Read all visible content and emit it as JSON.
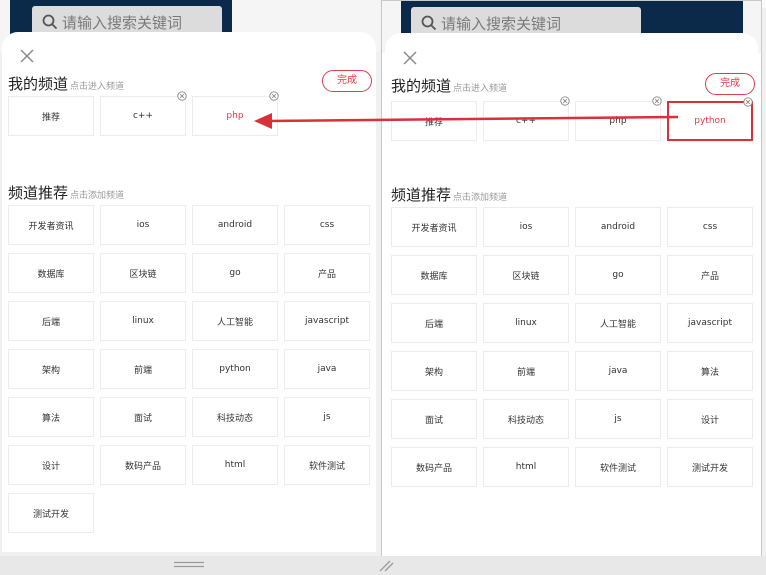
{
  "search": {
    "placeholder": "请输入搜索关键词"
  },
  "my_channels": {
    "title": "我的频道",
    "hint": "点击进入频道",
    "done_label": "完成"
  },
  "recommend": {
    "title": "频道推荐",
    "hint": "点击添加频道"
  },
  "left": {
    "my_items": [
      "推荐",
      "c++",
      "php"
    ],
    "rec_items": [
      "开发者资讯",
      "ios",
      "android",
      "css",
      "数据库",
      "区块链",
      "go",
      "产品",
      "后端",
      "linux",
      "人工智能",
      "javascript",
      "架构",
      "前端",
      "python",
      "java",
      "算法",
      "面试",
      "科技动态",
      "js",
      "设计",
      "数码产品",
      "html",
      "软件测试",
      "测试开发"
    ]
  },
  "right": {
    "my_items": [
      "推荐",
      "c++",
      "php",
      "python"
    ],
    "rec_items": [
      "开发者资讯",
      "ios",
      "android",
      "css",
      "数据库",
      "区块链",
      "go",
      "产品",
      "后端",
      "linux",
      "人工智能",
      "javascript",
      "架构",
      "前端",
      "java",
      "算法",
      "面试",
      "科技动态",
      "js",
      "设计",
      "数码产品",
      "html",
      "软件测试",
      "测试开发"
    ]
  },
  "colors": {
    "accent": "#e03c4a",
    "navbar": "#0b2a4a",
    "arrow": "#d9303a"
  },
  "icons": [
    "search-icon",
    "close-icon",
    "delete-circle-icon",
    "drag-handle-icon",
    "resize-grip-icon"
  ]
}
